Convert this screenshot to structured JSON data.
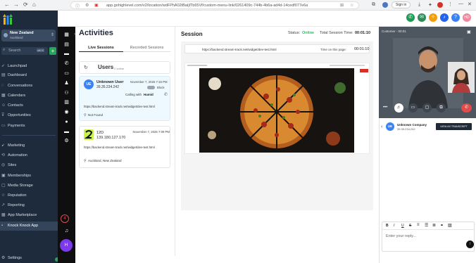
{
  "browser": {
    "url": "app.gohighlevel.com/v2/location/wdFPhA02tBaIjlTb65Vf/custom-menu-link/0261409c-744b-4b6a-ad4d-14cedf077e6a",
    "sign_in": "Sign in"
  },
  "sidebar": {
    "account_name": "New Zealand",
    "account_sub": "Auckland",
    "search_placeholder": "Search",
    "search_kbd": "ctrl K",
    "items": [
      {
        "label": "Launchpad",
        "icon": "rocket-icon"
      },
      {
        "label": "Dashboard",
        "icon": "dashboard-icon"
      },
      {
        "label": "Conversations",
        "icon": "chat-icon"
      },
      {
        "label": "Calendars",
        "icon": "calendar-icon"
      },
      {
        "label": "Contacts",
        "icon": "contacts-icon"
      },
      {
        "label": "Opportunities",
        "icon": "funnel-icon"
      },
      {
        "label": "Payments",
        "icon": "payments-icon"
      },
      {
        "label": "Marketing",
        "icon": "marketing-icon"
      },
      {
        "label": "Automation",
        "icon": "automation-icon"
      },
      {
        "label": "Sites",
        "icon": "globe-icon"
      },
      {
        "label": "Memberships",
        "icon": "membership-icon"
      },
      {
        "label": "Media Storage",
        "icon": "media-icon"
      },
      {
        "label": "Reputation",
        "icon": "star-icon"
      },
      {
        "label": "Reporting",
        "icon": "chart-icon"
      },
      {
        "label": "App Marketplace",
        "icon": "apps-icon"
      },
      {
        "label": "Knock Knock App",
        "icon": "app-icon"
      }
    ],
    "settings": "Settings"
  },
  "activities": {
    "title": "Activities",
    "tab_live": "Live Sessions",
    "tab_recorded": "Recorded Sessions",
    "users_label": "Users",
    "users_count": "2 online",
    "visitors": [
      {
        "initials": "UE",
        "name": "Unknown User",
        "ip": "39.35.234.242",
        "date": "November 7, 2025 7:15 PM",
        "toggle_label": "Block",
        "calling_prefix": "Calling with",
        "calling_name": "Hamid",
        "url": "https://backend.stream-track.net/widget/dev-test.html",
        "location": "Not Found"
      },
      {
        "name": "12D",
        "ip": "139.180.127.170",
        "date": "November 7, 2025 7:09 PM",
        "url": "https://backend.stream-track.net/widget/dev-test.html",
        "location": "Auckland, New Zealand"
      }
    ]
  },
  "session": {
    "title": "Session",
    "status_label": "Status:",
    "status_value": "Online",
    "total_label": "Total Session Time:",
    "total_value": "00:01:10",
    "page_url": "https://backend.stream-track.net/widget/dev-test.html",
    "time_label": "Time on this page:",
    "time_value": "00:01:10"
  },
  "video": {
    "label": "Customer - 00:01"
  },
  "chat": {
    "contact_initials": "UE",
    "contact_name": "Unknown Company",
    "contact_ip": "39.35.234.242",
    "view_transcript": "VIEW AS TRANSCRIPT",
    "reply_placeholder": "Enter your reply...",
    "toolbar": [
      "B",
      "I",
      "U",
      "S"
    ]
  },
  "colors": {
    "sidebar_bg": "#1e2b3c",
    "accent_purple": "#7c3aed",
    "online_green": "#22c55e",
    "end_call_red": "#e04b4b"
  }
}
